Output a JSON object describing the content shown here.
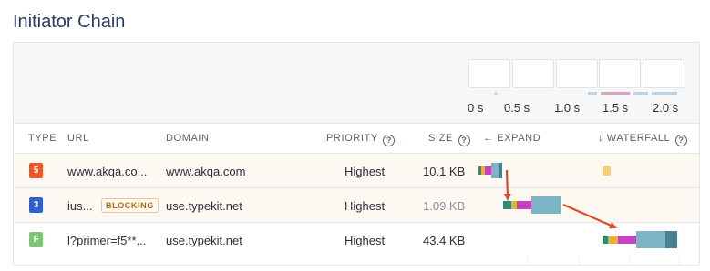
{
  "title": "Initiator Chain",
  "timeline_ticks": [
    "0 s",
    "0.5 s",
    "1.0 s",
    "1.5 s",
    "2.0 s"
  ],
  "columns": {
    "type": "TYPE",
    "url": "URL",
    "domain": "DOMAIN",
    "priority": "PRIORITY",
    "size": "SIZE",
    "expand": "← EXPAND",
    "waterfall": "↓ WATERFALL",
    "help": "?"
  },
  "rows": [
    {
      "type": "html",
      "badge": "5",
      "url": "www.akqa.co...",
      "domain": "www.akqa.com",
      "priority": "Highest",
      "size": "10.1 KB",
      "blocking": ""
    },
    {
      "type": "css",
      "badge": "3",
      "url": "ius...",
      "domain": "use.typekit.net",
      "priority": "Highest",
      "size": "1.09 KB",
      "blocking": "BLOCKING"
    },
    {
      "type": "font",
      "badge": "F",
      "url": "l?primer=f5**...",
      "domain": "use.typekit.net",
      "priority": "Highest",
      "size": "43.4 KB",
      "blocking": ""
    }
  ],
  "colors": {
    "html_badge": "#e8582b",
    "css_badge": "#2f5fd0",
    "font_badge": "#7cc576",
    "arrow": "#e04a1f",
    "row_highlight": "#fdf9f2"
  }
}
